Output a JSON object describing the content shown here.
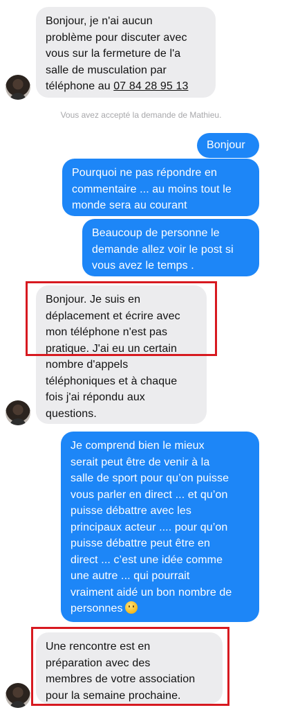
{
  "messages": {
    "m1_text": "Bonjour, je n'ai aucun\nproblème pour discuter avec\nvous sur la fermeture de l'a\nsalle de musculation par\ntéléphone au ",
    "m1_phone": "07 84 28 95 13",
    "system_note": "Vous avez accepté la demande de Mathieu.",
    "m2": "Bonjour",
    "m3": "Pourquoi ne pas répondre en\ncommentaire ... au moins tout le\nmonde sera au courant",
    "m4": "Beaucoup de personne le\ndemande allez voir le post si\nvous avez le temps .",
    "m5": "Bonjour. Je suis en\ndéplacement et écrire avec\nmon téléphone n'est pas\npratique. J'ai eu un certain\nnombre d'appels\ntéléphoniques et à chaque\nfois j'ai répondu aux\nquestions.",
    "m6": "Je comprend bien le mieux\nserait peut être de venir à la\nsalle de sport  pour qu’on puisse\nvous parler en direct ... et qu’on\npuisse débattre avec les\nprincipaux acteur .... pour qu’on\npuisse débattre peut être en\ndirect ... c’est une idée comme\nune autre ... qui pourrait\nvraiment aidé un bon nombre de\npersonnes",
    "m7": "Une rencontre est en\npréparation avec des\nmembres de votre association\npour la semaine prochaine."
  },
  "icons": {
    "avatar": "contact-avatar",
    "emoji": "slightly-smiling-face-emoji"
  },
  "colors": {
    "incoming_bubble": "#ececee",
    "outgoing_bubble": "#1d86f7",
    "highlight_box": "#d71920"
  }
}
